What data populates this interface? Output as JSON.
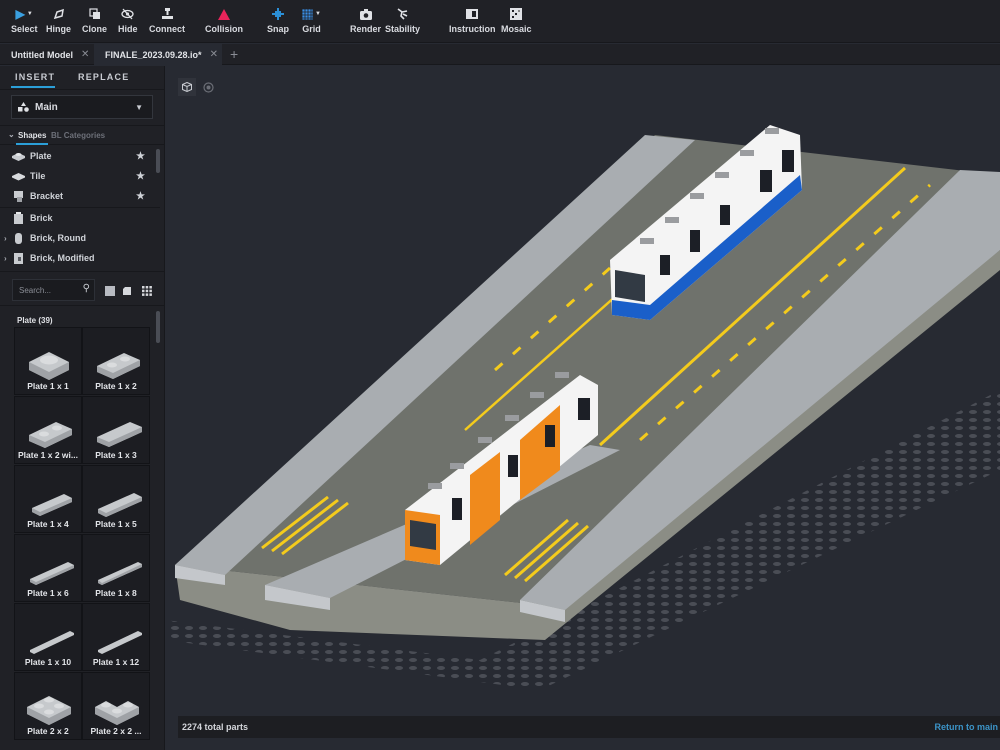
{
  "toolbar": {
    "tools": [
      {
        "label": "Select",
        "icon": "cursor-arrow-icon",
        "has_dropdown": true
      },
      {
        "label": "Hinge",
        "icon": "hinge-icon"
      },
      {
        "label": "Clone",
        "icon": "clone-icon"
      },
      {
        "label": "Hide",
        "icon": "eye-slash-icon"
      },
      {
        "label": "Connect",
        "icon": "connect-icon"
      },
      {
        "label": "Collision",
        "icon": "warning-triangle-icon"
      },
      {
        "label": "Snap",
        "icon": "snap-icon"
      },
      {
        "label": "Grid",
        "icon": "grid-icon",
        "has_dropdown": true
      },
      {
        "label": "Render",
        "icon": "camera-icon"
      },
      {
        "label": "Stability",
        "icon": "stability-icon"
      },
      {
        "label": "Instruction",
        "icon": "book-icon"
      },
      {
        "label": "Mosaic",
        "icon": "mosaic-icon"
      }
    ],
    "colors": {
      "select": "#3aa0e0",
      "collision": "#e8245a",
      "snap": "#2b8fd6",
      "grid": "#3a8fe6"
    }
  },
  "tabs": {
    "items": [
      {
        "label": "Untitled Model",
        "active": false
      },
      {
        "label": "FINALE_2023.09.28.io*",
        "active": true
      }
    ],
    "close_glyph": "✕",
    "add_glyph": "+"
  },
  "sidebar": {
    "modes": [
      "INSERT",
      "REPLACE"
    ],
    "active_mode": "INSERT",
    "palette_dropdown": {
      "value": "Main"
    },
    "category_tabs": {
      "shapes": "Shapes",
      "bl": "BL Categories"
    },
    "shapes": [
      {
        "label": "Plate",
        "favorite": true
      },
      {
        "label": "Tile",
        "favorite": true
      },
      {
        "label": "Bracket",
        "favorite": true
      },
      {
        "label": "Brick",
        "expandable": false
      },
      {
        "label": "Brick, Round",
        "expandable": true
      },
      {
        "label": "Brick, Modified",
        "expandable": true
      }
    ],
    "search": {
      "placeholder": "Search..."
    },
    "group_title": "Plate (39)",
    "parts": [
      "Plate 1 x 1",
      "Plate 1 x 2",
      "Plate 1 x 2 wi...",
      "Plate 1 x 3",
      "Plate 1 x 4",
      "Plate 1 x 5",
      "Plate 1 x 6",
      "Plate 1 x 8",
      "Plate 1 x 10",
      "Plate 1 x 12",
      "Plate 2 x 2",
      "Plate 2 x 2 ..."
    ]
  },
  "status": {
    "parts_count": "2274 total parts",
    "return_link": "Return to main"
  },
  "scene": {
    "description": "Isometric LEGO tram station model with two trams",
    "trams": [
      {
        "color_primary": "#ffffff",
        "color_accent": "#1a5fc9"
      },
      {
        "color_primary": "#f08a1c",
        "color_accent": "#ffffff"
      }
    ],
    "road_marking_color": "#f4cb1c"
  },
  "accent": "#2b9fd8"
}
